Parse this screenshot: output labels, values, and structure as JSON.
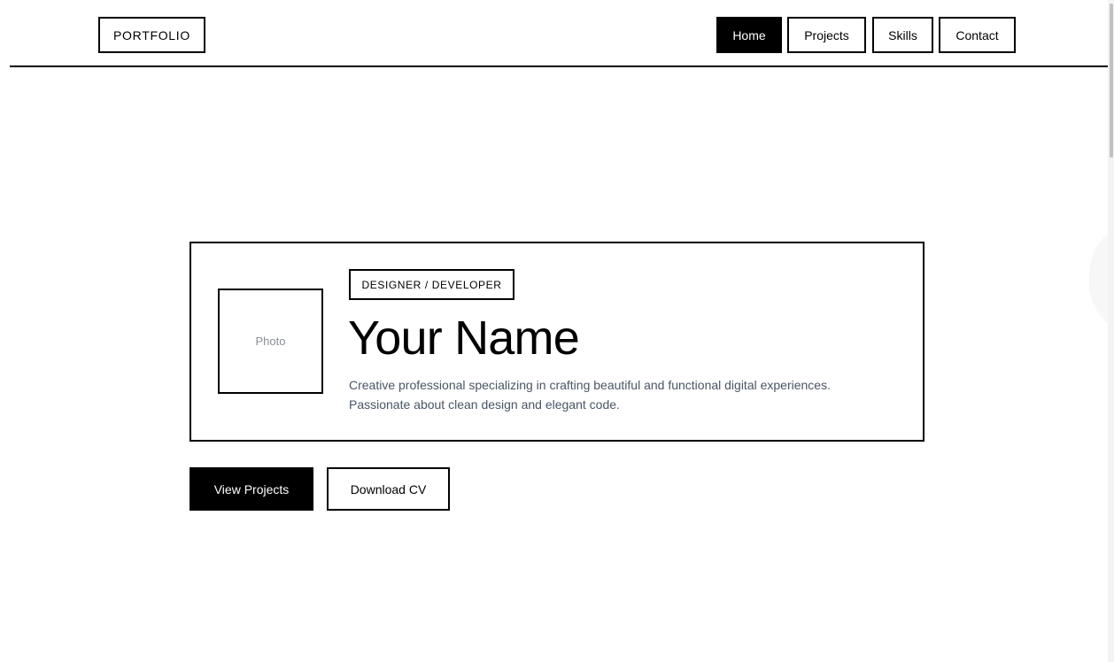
{
  "header": {
    "logo": "PORTFOLIO",
    "nav": [
      {
        "label": "Home",
        "active": true
      },
      {
        "label": "Projects",
        "active": false
      },
      {
        "label": "Skills",
        "active": false
      },
      {
        "label": "Contact",
        "active": false
      }
    ]
  },
  "hero": {
    "photo_label": "Photo",
    "role": "DESIGNER / DEVELOPER",
    "name": "Your Name",
    "bio_lines": [
      "Creative professional specializing in crafting beautiful and functional digital experiences.",
      "Passionate about clean design and elegant code."
    ]
  },
  "actions": {
    "primary": "View Projects",
    "secondary": "Download CV"
  },
  "colors": {
    "accent": "#000000",
    "background": "#ffffff",
    "muted_text": "#4a5565",
    "placeholder_text": "#8a8f98"
  }
}
